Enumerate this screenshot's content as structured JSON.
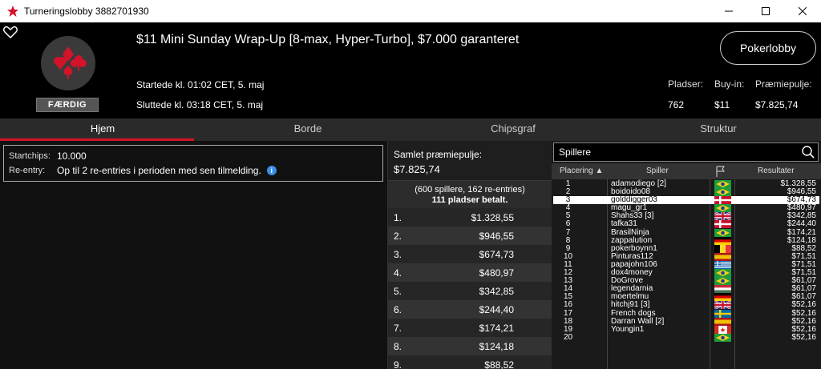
{
  "window": {
    "title": "Turneringslobby 3882701930"
  },
  "header": {
    "tournament_name": "$11 Mini Sunday Wrap-Up [8-max, Hyper-Turbo], $7.000 garanteret",
    "started": "Startede kl. 01:02 CET, 5. maj",
    "ended": "Sluttede kl. 03:18 CET, 5. maj",
    "status_badge": "FÆRDIG",
    "lobby_button": "Pokerlobby",
    "stats": [
      {
        "label": "Pladser:",
        "value": "762"
      },
      {
        "label": "Buy-in:",
        "value": "$11"
      },
      {
        "label": "Præmiepulje:",
        "value": "$7.825,74"
      }
    ]
  },
  "tabs": [
    "Hjem",
    "Borde",
    "Chipsgraf",
    "Struktur"
  ],
  "active_tab": "Hjem",
  "info": {
    "startchips_label": "Startchips:",
    "startchips_value": "10.000",
    "reentry_label": "Re-entry:",
    "reentry_value": "Op til 2 re-entries i perioden med sen tilmelding.",
    "info_icon": "i"
  },
  "prizes": {
    "title": "Samlet præmiepulje:",
    "total": "$7.825,74",
    "players_line": "(600 spillere, 162 re-entries)",
    "paid_line": "111 pladser betalt.",
    "rows": [
      {
        "pos": "1.",
        "amount": "$1.328,55"
      },
      {
        "pos": "2.",
        "amount": "$946,55"
      },
      {
        "pos": "3.",
        "amount": "$674,73"
      },
      {
        "pos": "4.",
        "amount": "$480,97"
      },
      {
        "pos": "5.",
        "amount": "$342,85"
      },
      {
        "pos": "6.",
        "amount": "$244,40"
      },
      {
        "pos": "7.",
        "amount": "$174,21"
      },
      {
        "pos": "8.",
        "amount": "$124,18"
      },
      {
        "pos": "9.",
        "amount": "$88,52"
      }
    ]
  },
  "players": {
    "search_placeholder": "Spillere",
    "columns": {
      "place": "Placering",
      "player": "Spiller",
      "results": "Resultater"
    },
    "highlighted_rank": "3",
    "rows": [
      {
        "rank": "1",
        "name": "adamodiego [2]",
        "flag": "br",
        "result": "$1.328,55"
      },
      {
        "rank": "2",
        "name": "boidoido08",
        "flag": "br",
        "result": "$946,55"
      },
      {
        "rank": "3",
        "name": "golddigger03",
        "flag": "dk",
        "result": "$674,73"
      },
      {
        "rank": "4",
        "name": "magu_gr1",
        "flag": "br",
        "result": "$480,97"
      },
      {
        "rank": "5",
        "name": "Shahs33 [3]",
        "flag": "gb",
        "result": "$342,85"
      },
      {
        "rank": "6",
        "name": "tafka31",
        "flag": "dk",
        "result": "$244,40"
      },
      {
        "rank": "7",
        "name": "BrasilNinja",
        "flag": "br",
        "result": "$174,21"
      },
      {
        "rank": "8",
        "name": "zappalution",
        "flag": "de",
        "result": "$124,18"
      },
      {
        "rank": "9",
        "name": "pokerboynn1",
        "flag": "be",
        "result": "$88,52"
      },
      {
        "rank": "10",
        "name": "Pinturas112",
        "flag": "es",
        "result": "$71,51"
      },
      {
        "rank": "11",
        "name": "papajohn106",
        "flag": "gr",
        "result": "$71,51"
      },
      {
        "rank": "12",
        "name": "dox4money",
        "flag": "br",
        "result": "$71,51"
      },
      {
        "rank": "13",
        "name": "DoGrove",
        "flag": "br",
        "result": "$61,07"
      },
      {
        "rank": "14",
        "name": "legendarnia",
        "flag": "hu",
        "result": "$61,07"
      },
      {
        "rank": "15",
        "name": "moertelmu",
        "flag": "de",
        "result": "$61,07"
      },
      {
        "rank": "16",
        "name": "hitchj91 [3]",
        "flag": "gb",
        "result": "$52,16"
      },
      {
        "rank": "17",
        "name": "French dogs",
        "flag": "se",
        "result": "$52,16"
      },
      {
        "rank": "18",
        "name": "Darran Wall [2]",
        "flag": "es",
        "result": "$52,16"
      },
      {
        "rank": "19",
        "name": "Youngin1",
        "flag": "ca",
        "result": "$52,16"
      },
      {
        "rank": "20",
        "name": "",
        "flag": "br",
        "result": "$52,16"
      }
    ]
  }
}
